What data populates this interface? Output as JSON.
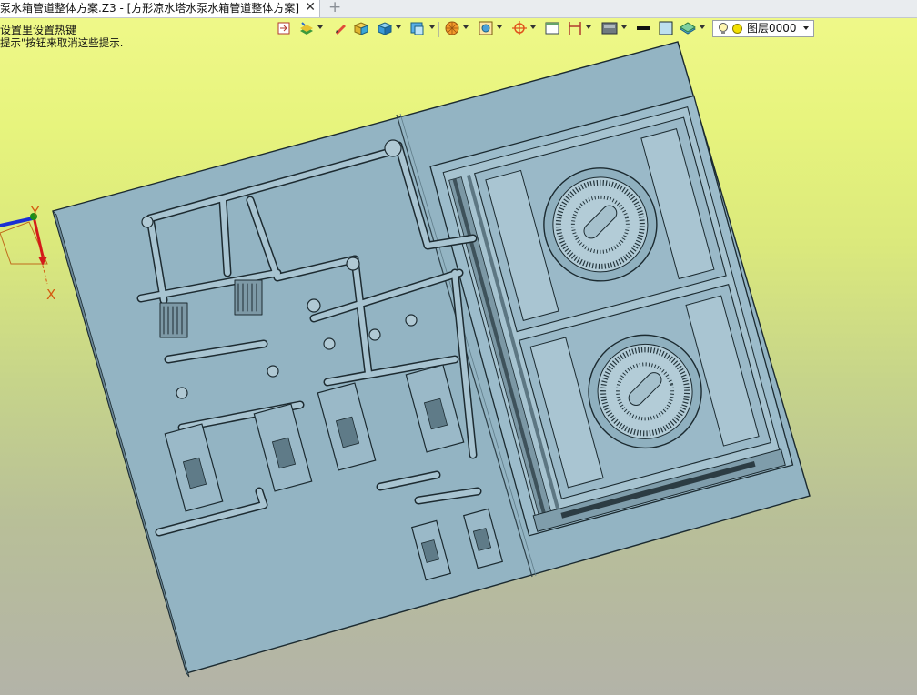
{
  "tab": {
    "title": "泵水箱管道整体方案.Z3 - [方形凉水塔水泵水箱管道整体方案]",
    "close_glyph": "✕",
    "new_tab_glyph": "+"
  },
  "hints": {
    "line1": "设置里设置热键",
    "line2": "提示\"按钮来取消这些提示."
  },
  "toolbar": {
    "icons": [
      "insert-icon",
      "layers-stack-icon",
      "pencil-icon",
      "box-shaded-icon",
      "cube-blue-icon",
      "view-cube-icon",
      "render-sphere-icon",
      "frame-icon",
      "snap-target-icon",
      "window-icon",
      "dimension-icon",
      "display-mode-icon",
      "line-color-swatch",
      "fill-color-swatch",
      "plane-icon"
    ],
    "layer": {
      "value": "图层0000",
      "icon": "bulb-icon",
      "color": "#f3e000"
    }
  },
  "viewport": {
    "background_top": "#f0f98a",
    "background_bottom": "#b3b3a8",
    "model_color": "#93b4c3",
    "axis_label_x": "X",
    "axis_label_y": "Y"
  }
}
